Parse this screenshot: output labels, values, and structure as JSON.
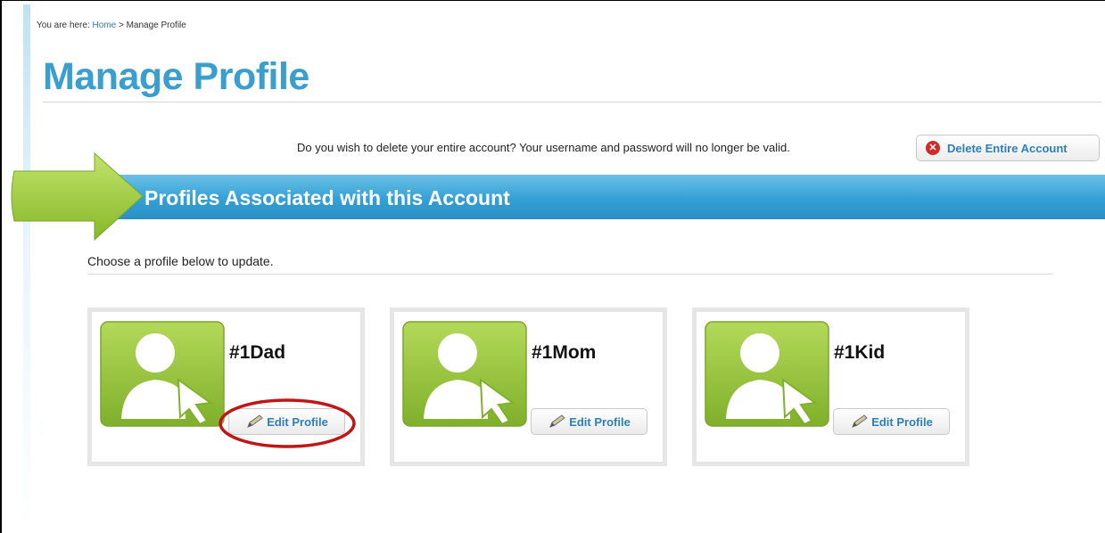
{
  "breadcrumb": {
    "prefix": "You are here:",
    "home": "Home",
    "separator": ">",
    "current": "Manage Profile"
  },
  "page": {
    "title": "Manage Profile"
  },
  "account": {
    "delete_message": "Do you wish to delete your entire account? Your username and password will no longer be valid.",
    "delete_button_label": "Delete Entire Account",
    "delete_icon_glyph": "✕"
  },
  "section": {
    "title": "Profiles Associated with this Account",
    "instruction": "Choose a profile below to update."
  },
  "profiles": [
    {
      "name": "#1Dad",
      "edit_label": "Edit Profile"
    },
    {
      "name": "#1Mom",
      "edit_label": "Edit Profile"
    },
    {
      "name": "#1Kid",
      "edit_label": "Edit Profile"
    }
  ],
  "colors": {
    "title_blue": "#3a9fcf",
    "link_blue": "#2d7fb8",
    "bar_blue": "#33a0d6",
    "avatar_green": "#8dc035",
    "arrow_green": "#9acb3c",
    "highlight_red": "#c01616",
    "delete_red": "#d22a2a"
  },
  "icons": {
    "delete": "delete-circle-icon",
    "arrow": "green-arrow-icon",
    "avatar": "user-cursor-avatar-icon",
    "edit": "pencil-icon"
  }
}
